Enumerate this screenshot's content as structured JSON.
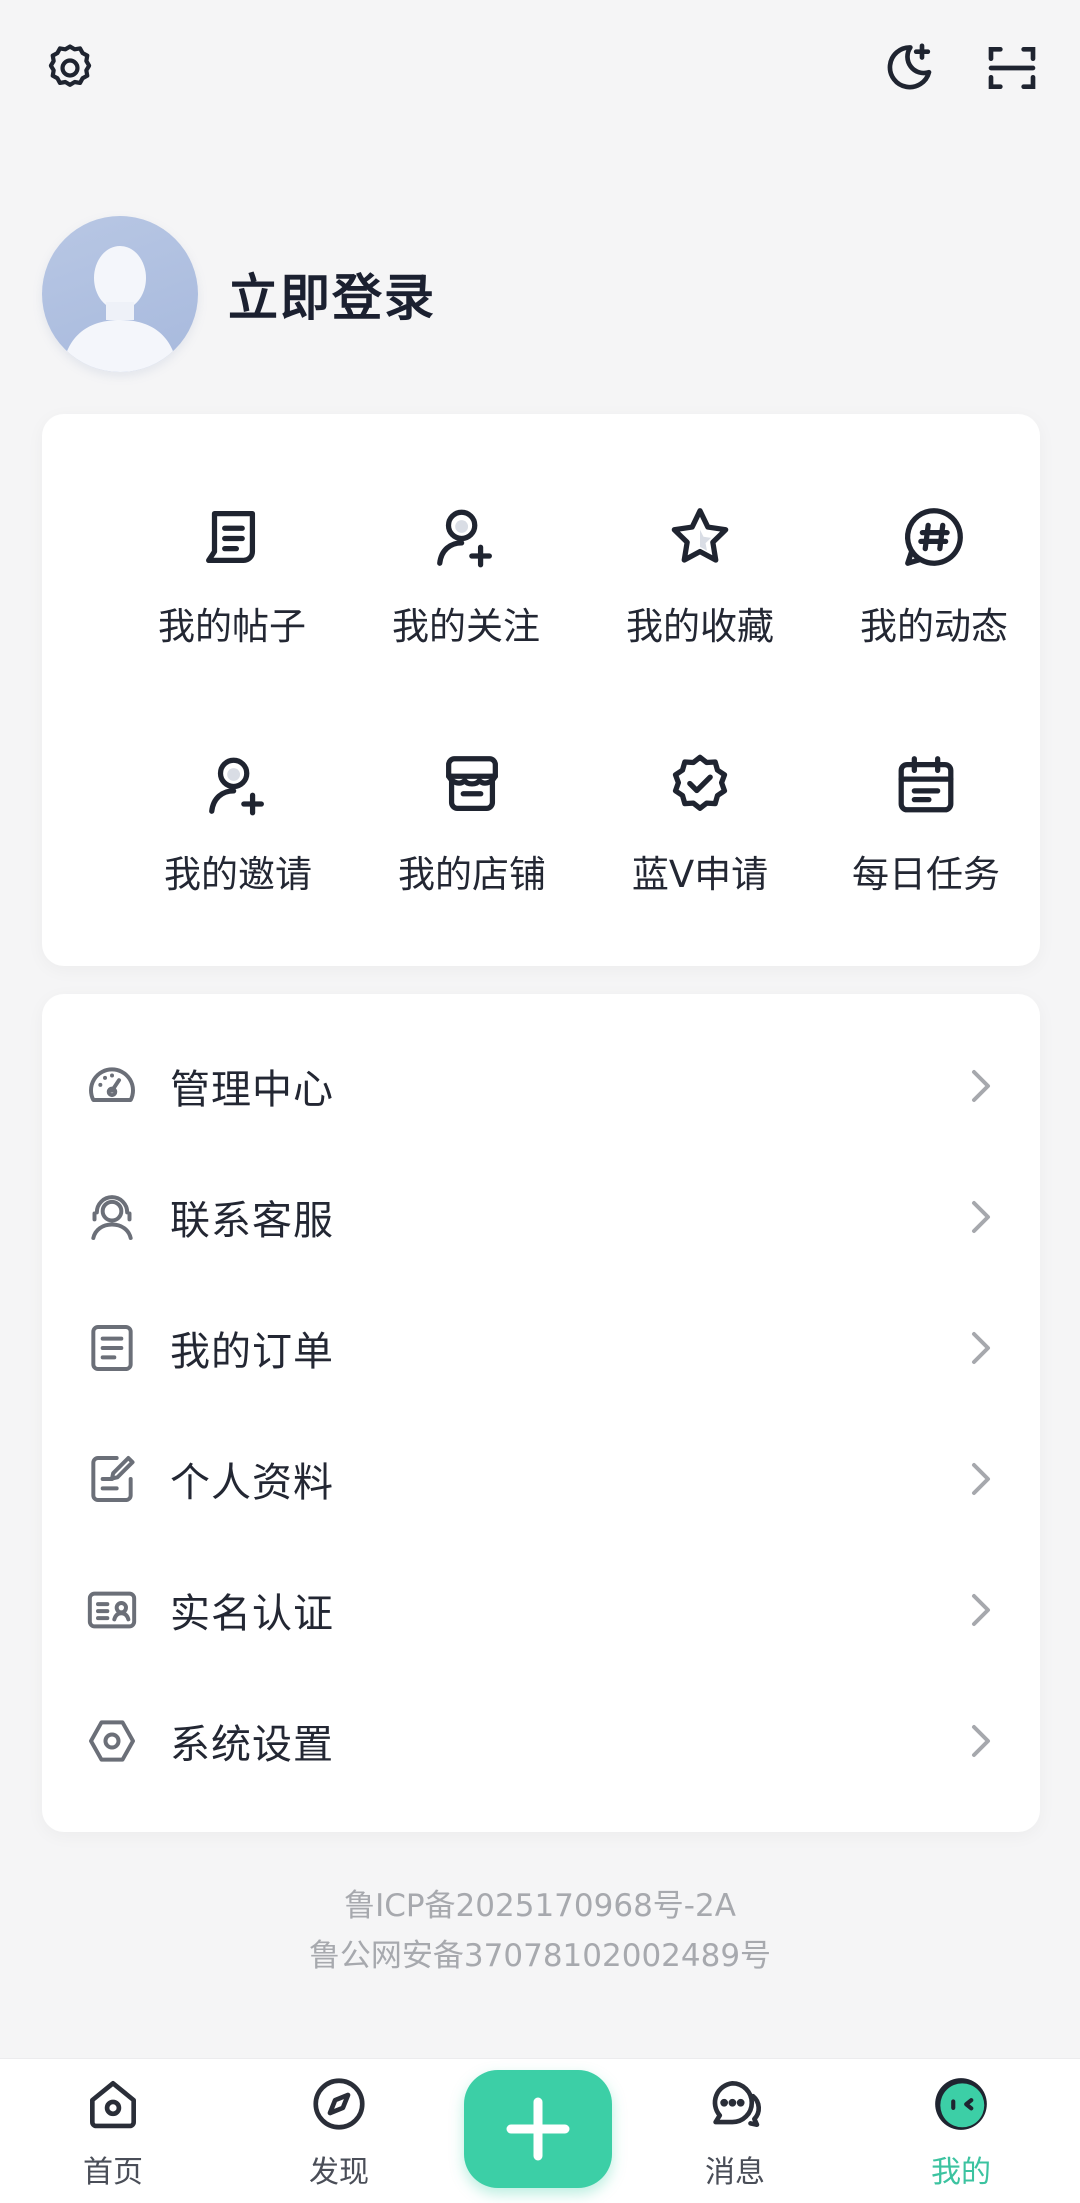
{
  "header": {
    "icons": [
      "gear-icon",
      "moon-plus-icon",
      "scan-icon"
    ]
  },
  "profile": {
    "login_text": "立即登录"
  },
  "shortcuts": [
    {
      "label": "我的帖子",
      "icon": "post-icon"
    },
    {
      "label": "我的关注",
      "icon": "user-plus-icon"
    },
    {
      "label": "我的收藏",
      "icon": "star-icon"
    },
    {
      "label": "我的动态",
      "icon": "hashtag-icon"
    },
    {
      "label": "我的邀请",
      "icon": "user-plus-icon"
    },
    {
      "label": "我的店铺",
      "icon": "store-icon"
    },
    {
      "label": "蓝V申请",
      "icon": "verified-badge-icon"
    },
    {
      "label": "每日任务",
      "icon": "calendar-icon"
    }
  ],
  "menu": [
    {
      "label": "管理中心",
      "icon": "dashboard-icon"
    },
    {
      "label": "联系客服",
      "icon": "customer-service-icon"
    },
    {
      "label": "我的订单",
      "icon": "order-icon"
    },
    {
      "label": "个人资料",
      "icon": "edit-profile-icon"
    },
    {
      "label": "实名认证",
      "icon": "id-card-icon"
    },
    {
      "label": "系统设置",
      "icon": "hexagon-settings-icon"
    }
  ],
  "footer": {
    "icp": "鲁ICP备2025170968号-2A",
    "police": "鲁公网安备37078102002489号"
  },
  "nav": {
    "home": "首页",
    "discover": "发现",
    "messages": "消息",
    "me": "我的"
  },
  "colors": {
    "accent": "#3ccfa6",
    "active_text": "#3cc3a0",
    "background": "#f5f5f6",
    "card": "#ffffff",
    "footer_text": "#a7a9ae"
  }
}
